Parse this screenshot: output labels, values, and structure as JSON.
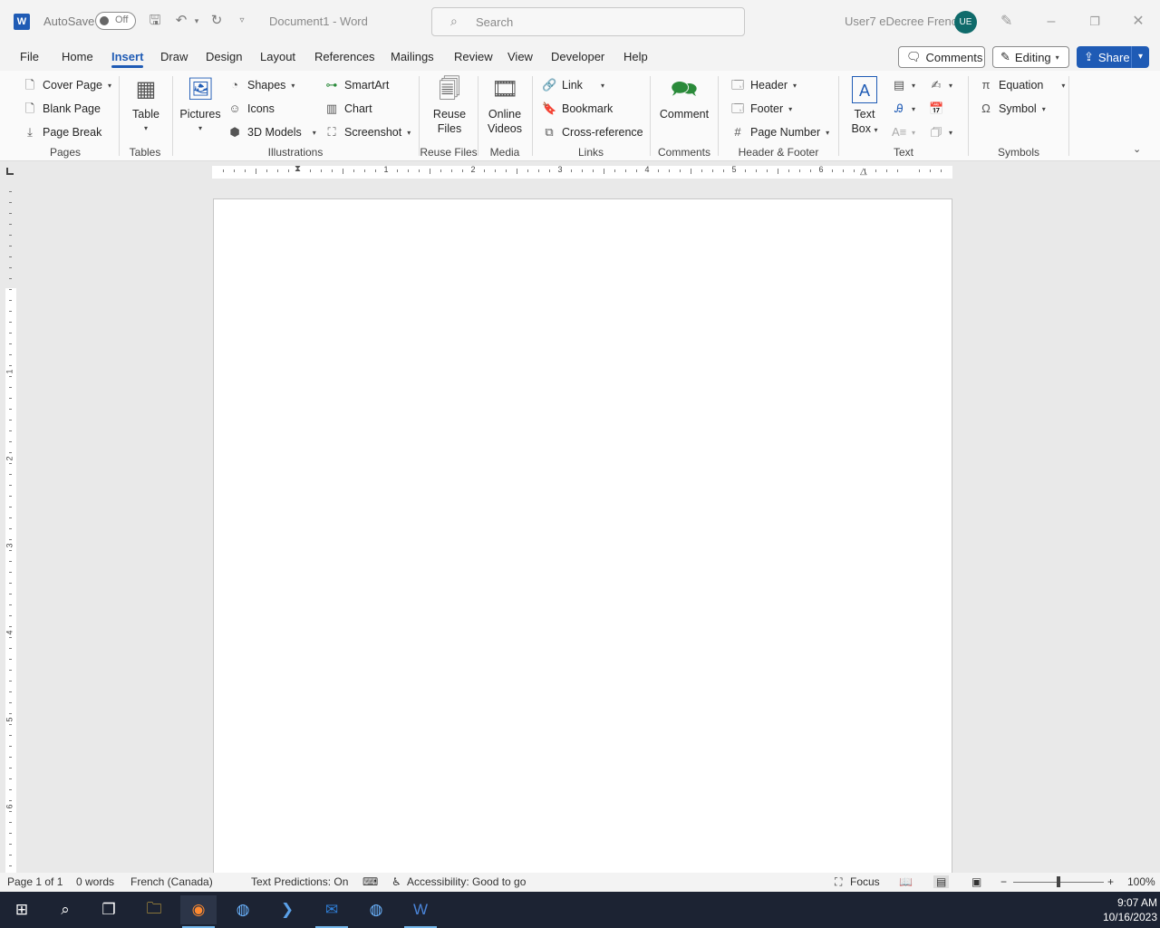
{
  "titlebar": {
    "app_logo": "W",
    "autosave_label": "AutoSave",
    "autosave_state": "Off",
    "doc_title": "Document1  -  Word",
    "search_placeholder": "Search",
    "user_name": "User7 eDecree French",
    "user_initials": "UE"
  },
  "tabs": [
    "File",
    "Home",
    "Insert",
    "Draw",
    "Design",
    "Layout",
    "References",
    "Mailings",
    "Review",
    "View",
    "Developer",
    "Help"
  ],
  "active_tab": "Insert",
  "header_actions": {
    "comments": "Comments",
    "editing": "Editing",
    "share": "Share"
  },
  "ribbon": {
    "pages": {
      "label": "Pages",
      "cover_page": "Cover Page",
      "blank_page": "Blank Page",
      "page_break": "Page Break"
    },
    "tables": {
      "label": "Tables",
      "table": "Table"
    },
    "illustrations": {
      "label": "Illustrations",
      "pictures": "Pictures",
      "shapes": "Shapes",
      "icons": "Icons",
      "models_3d": "3D Models",
      "smartart": "SmartArt",
      "chart": "Chart",
      "screenshot": "Screenshot"
    },
    "reuse_files": {
      "label": "Reuse Files",
      "reuse_l1": "Reuse",
      "reuse_l2": "Files"
    },
    "media": {
      "label": "Media",
      "online_l1": "Online",
      "online_l2": "Videos"
    },
    "links": {
      "label": "Links",
      "link": "Link",
      "bookmark": "Bookmark",
      "cross_reference": "Cross-reference"
    },
    "comments": {
      "label": "Comments",
      "comment": "Comment"
    },
    "header_footer": {
      "label": "Header & Footer",
      "header": "Header",
      "footer": "Footer",
      "page_number": "Page Number"
    },
    "text": {
      "label": "Text",
      "textbox_l1": "Text",
      "textbox_l2": "Box"
    },
    "symbols": {
      "label": "Symbols",
      "equation": "Equation",
      "symbol": "Symbol"
    }
  },
  "ruler": {
    "h_numbers": [
      "1",
      "2",
      "3",
      "4",
      "5",
      "6"
    ],
    "v_numbers": [
      "1",
      "2",
      "3",
      "4",
      "5",
      "6"
    ]
  },
  "status": {
    "page": "Page 1 of 1",
    "words": "0 words",
    "language": "French (Canada)",
    "predictions": "Text Predictions: On",
    "accessibility": "Accessibility: Good to go",
    "focus": "Focus",
    "zoom": "100%"
  },
  "taskbar": {
    "time": "9:07 AM",
    "date": "10/16/2023"
  },
  "colors": {
    "accent": "#1f5bb5",
    "avatar": "#0f6b6b",
    "taskbar": "#1c2333"
  }
}
